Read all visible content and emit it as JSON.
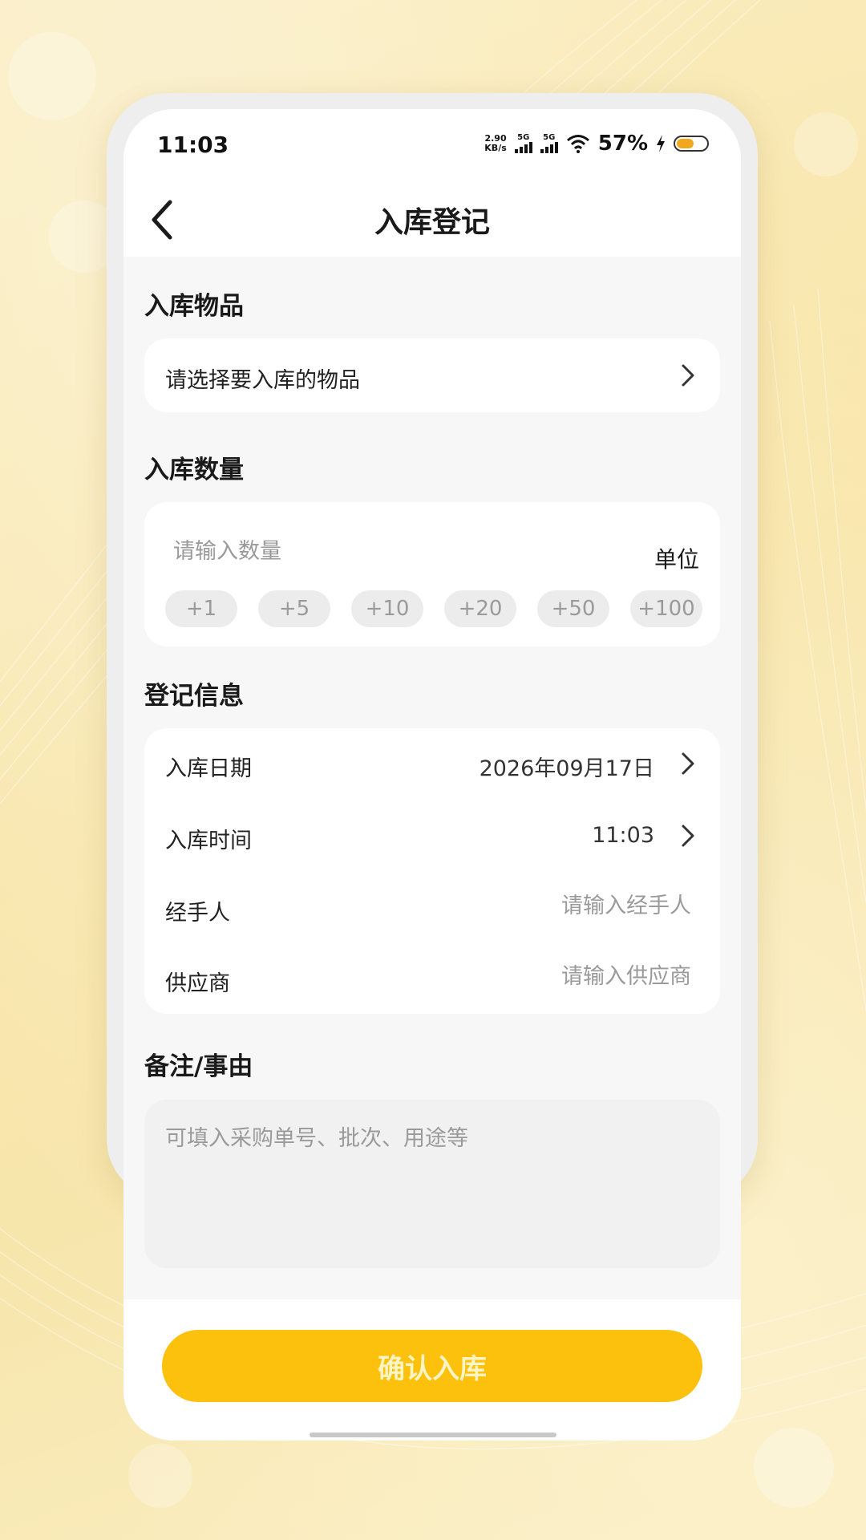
{
  "status_bar": {
    "time": "11:03",
    "net_speed_value": "2.90",
    "net_speed_unit": "KB/s",
    "signal_1_label": "5G",
    "signal_2_label": "5G",
    "battery_percent": "57%",
    "battery_level": 0.57,
    "icons": [
      "signal-icon",
      "wifi-icon",
      "charging-icon",
      "battery-icon"
    ]
  },
  "header": {
    "title": "入库登记",
    "back_icon": "chevron-left-icon"
  },
  "item_section": {
    "title": "入库物品",
    "picker_label": "请选择要入库的物品"
  },
  "quantity_section": {
    "title": "入库数量",
    "input_placeholder": "请输入数量",
    "unit_label": "单位",
    "quick_adds": [
      "+1",
      "+5",
      "+10",
      "+20",
      "+50",
      "+100"
    ]
  },
  "info_section": {
    "title": "登记信息",
    "date_label": "入库日期",
    "date_value": "2026年09月17日",
    "time_label": "入库时间",
    "time_value": "11:03",
    "handler_label": "经手人",
    "handler_placeholder": "请输入经手人",
    "supplier_label": "供应商",
    "supplier_placeholder": "请输入供应商"
  },
  "remark_section": {
    "title": "备注/事由",
    "placeholder": "可填入采购单号、批次、用途等"
  },
  "footer": {
    "confirm_label": "确认入库"
  },
  "colors": {
    "accent": "#fcc10c",
    "background": "#f8e4a6"
  }
}
